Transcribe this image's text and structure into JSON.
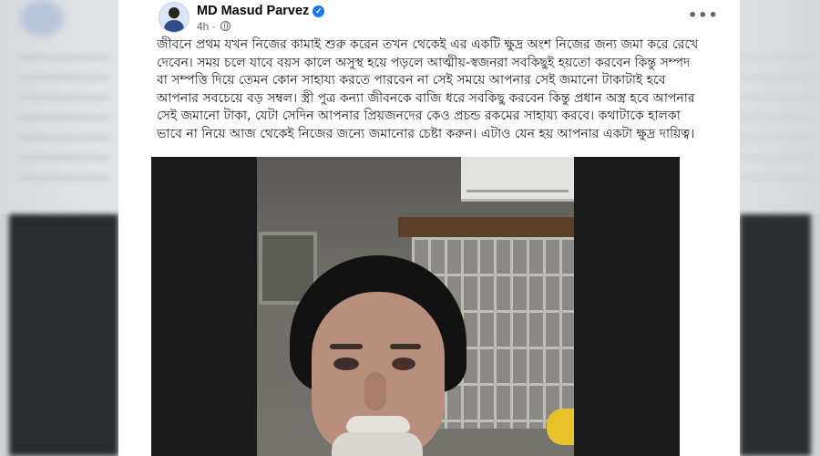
{
  "post": {
    "author": "MD Masud Parvez",
    "verified_icon": "verified-badge-icon",
    "time": "4h",
    "audience_icon": "globe-icon",
    "more_label": "•••",
    "text": "জীবনে প্রথম যখন নিজের কামাই শুরু করেন তখন থেকেই এর একটি ক্ষুদ্র অংশ নিজের জন্য জমা করে রেখে দেবেন। সময় চলে যাবে বয়স কালে অসুস্থ হয়ে পড়লে আত্মীয়-স্বজনরা সবকিছুই হয়তো করবেন কিন্তু সম্পদ বা সম্পত্তি দিয়ে তেমন কোন সাহায্য করতে পারবেন না সেই সময়ে আপনার সেই জমানো টাকাটাই হবে আপনার সবচেয়ে বড় সম্বল। স্ত্রী পুত্র কন্যা জীবনকে বাজি ধরে সবকিছু করবেন কিন্তু প্রধান অস্ত্র হবে আপনার সেই জমানো টাকা, যেটা সেদিন আপনার প্রিয়জনদের কেও প্রচন্ড রকমের সাহায্য করবে। কথাটাকে হালকা ভাবে না নিয়ে আজ থেকেই নিজের জন্যে জমানোর চেষ্টা করুন। এটাও যেন হয় আপনার একটা ক্ষুদ্র দায়িত্ব।"
  },
  "colors": {
    "verified": "#1877f2",
    "meta_text": "#65676b",
    "body_text": "#1c1e21"
  }
}
